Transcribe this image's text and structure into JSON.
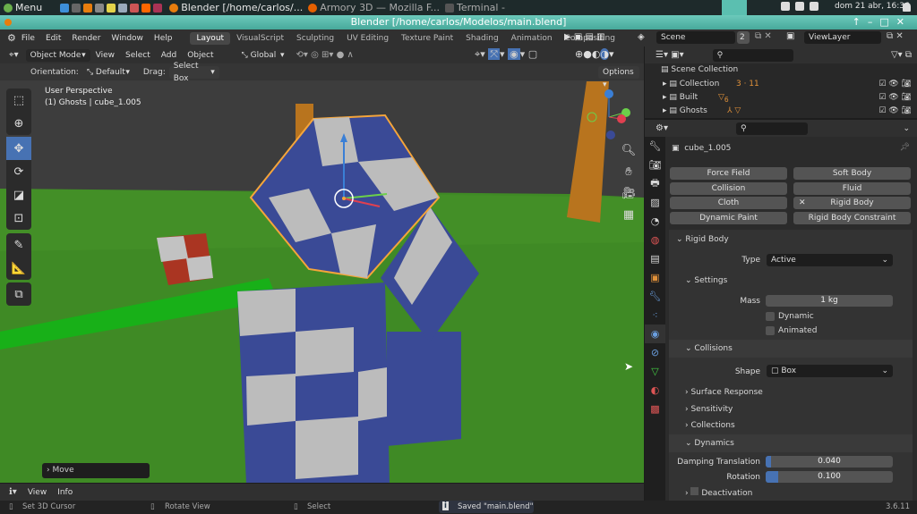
{
  "taskbar": {
    "menu": "Menu",
    "windows": [
      "Blender [/home/carlos/...",
      "Armory 3D — Mozilla F...",
      "Terminal -"
    ],
    "clock": "dom 21 abr, 16:36"
  },
  "titlebar": {
    "title": "Blender [/home/carlos/Modelos/main.blend]"
  },
  "topbar": {
    "menus": [
      "File",
      "Edit",
      "Render",
      "Window",
      "Help"
    ],
    "workspaces": [
      "Layout",
      "VisualScript",
      "Sculpting",
      "UV Editing",
      "Texture Paint",
      "Shading",
      "Animation",
      "Compositing"
    ],
    "active_workspace": "Layout",
    "scene": "Scene",
    "scene_users": "2",
    "view_layer": "ViewLayer"
  },
  "viewport_header": {
    "mode": "Object Mode",
    "menus": [
      "View",
      "Select",
      "Add",
      "Object"
    ],
    "transform_orientation": "Global"
  },
  "tool_settings": {
    "orientation_label": "Orientation:",
    "orientation": "Default",
    "drag_label": "Drag:",
    "drag": "Select Box",
    "options": "Options"
  },
  "viewport": {
    "view_name": "User Perspective",
    "context": "(1) Ghosts | cube_1.005",
    "last_op": "Move",
    "tools": [
      "select-box-icon",
      "cursor-icon",
      "move-icon",
      "rotate-icon",
      "scale-icon",
      "transform-icon",
      "annotate-icon",
      "measure-icon",
      "add-cube-icon"
    ],
    "active_tool": "move-icon"
  },
  "outliner": {
    "root": "Scene Collection",
    "items": [
      {
        "name": "Collection",
        "badges": "3 · 11"
      },
      {
        "name": "Built",
        "badges": "6"
      },
      {
        "name": "Ghosts",
        "badges": ""
      }
    ]
  },
  "properties": {
    "object_name": "cube_1.005",
    "physics_buttons": [
      "Force Field",
      "Soft Body",
      "Collision",
      "Fluid",
      "Cloth",
      "Rigid Body",
      "Dynamic Paint",
      "Rigid Body Constraint"
    ],
    "rigid_body": {
      "title": "Rigid Body",
      "type_label": "Type",
      "type": "Active",
      "settings": "Settings",
      "mass_label": "Mass",
      "mass": "1 kg",
      "dynamic": "Dynamic",
      "animated": "Animated",
      "collisions": "Collisions",
      "shape_label": "Shape",
      "shape": "Box",
      "surface_response": "Surface Response",
      "sensitivity": "Sensitivity",
      "collections": "Collections",
      "dynamics": "Dynamics",
      "damping_translation_label": "Damping Translation",
      "damping_translation": "0.040",
      "damping_translation_fraction": 0.04,
      "rotation_label": "Rotation",
      "rotation": "0.100",
      "rotation_fraction": 0.1,
      "deactivation": "Deactivation"
    }
  },
  "info_bar": {
    "menus": [
      "View",
      "Info"
    ]
  },
  "statusbar": {
    "set_cursor": "Set 3D Cursor",
    "rotate": "Rotate View",
    "select": "Select",
    "message": "Saved \"main.blend\"",
    "version": "3.6.11"
  },
  "colors": {
    "accent": "#4772b3",
    "selection": "#f5a53a",
    "title_bar": "#5bbfb0",
    "floor": "#3f8a25"
  }
}
